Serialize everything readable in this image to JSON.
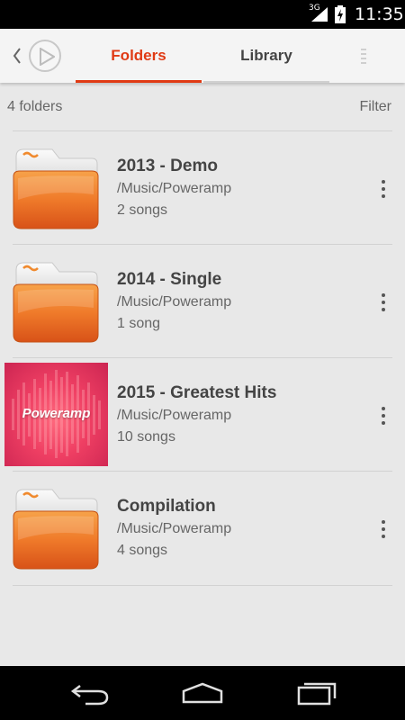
{
  "status_bar": {
    "network": "3G",
    "time": "11:35"
  },
  "header": {
    "tabs": [
      {
        "label": "Folders",
        "active": true
      },
      {
        "label": "Library",
        "active": false
      }
    ],
    "accent_color": "#e03a14"
  },
  "subheader": {
    "count_label": "4 folders",
    "filter_label": "Filter"
  },
  "folders": [
    {
      "title": "2013 - Demo",
      "path": "/Music/Poweramp",
      "count": "2 songs",
      "icon": "folder-icon"
    },
    {
      "title": "2014 - Single",
      "path": "/Music/Poweramp",
      "count": "1 song",
      "icon": "folder-icon"
    },
    {
      "title": "2015 - Greatest Hits",
      "path": "/Music/Poweramp",
      "count": "10 songs",
      "icon": "album-art",
      "art_label": "Poweramp"
    },
    {
      "title": "Compilation",
      "path": "/Music/Poweramp",
      "count": "4 songs",
      "icon": "folder-icon"
    }
  ],
  "nav_bar": {
    "icons": [
      "back-icon",
      "home-icon",
      "recent-apps-icon"
    ]
  }
}
